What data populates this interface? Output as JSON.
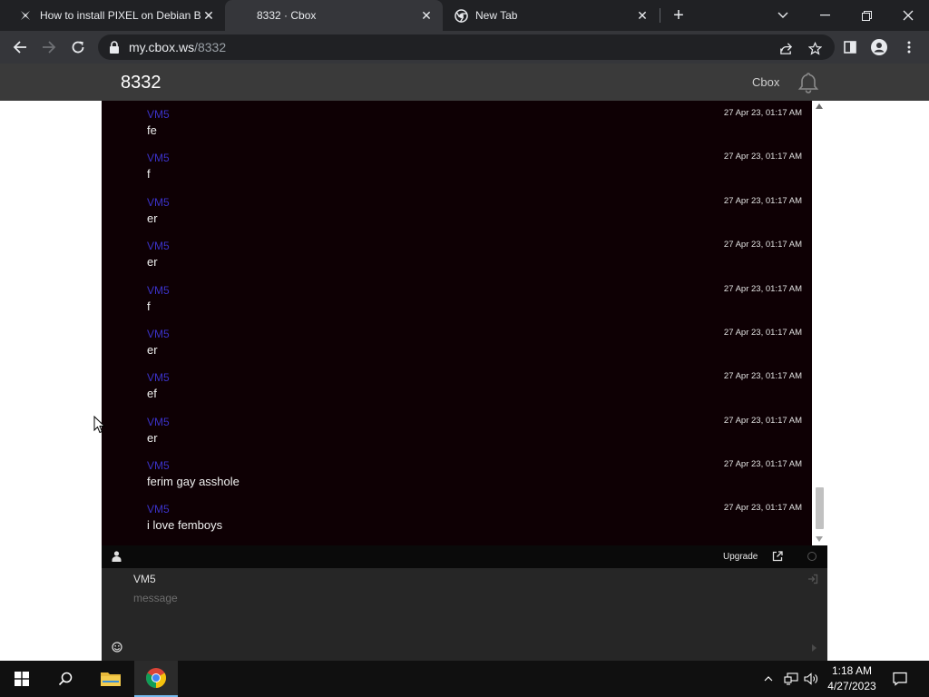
{
  "browser": {
    "tabs": [
      {
        "title": "How to install PIXEL on Debian B",
        "icon": "cross-logo-icon",
        "active": false
      },
      {
        "title": "8332 · Cbox",
        "icon": "none",
        "active": true
      },
      {
        "title": "New Tab",
        "icon": "chrome-icon",
        "active": false
      }
    ],
    "url_host": "my.cbox.ws",
    "url_path": "/8332"
  },
  "site": {
    "brand": "8332",
    "cbox_link": "Cbox"
  },
  "chat": {
    "messages": [
      {
        "user": "VM5",
        "time": "27 Apr 23, 01:17 AM",
        "text": "fe"
      },
      {
        "user": "VM5",
        "time": "27 Apr 23, 01:17 AM",
        "text": "f"
      },
      {
        "user": "VM5",
        "time": "27 Apr 23, 01:17 AM",
        "text": "er"
      },
      {
        "user": "VM5",
        "time": "27 Apr 23, 01:17 AM",
        "text": "er"
      },
      {
        "user": "VM5",
        "time": "27 Apr 23, 01:17 AM",
        "text": "f"
      },
      {
        "user": "VM5",
        "time": "27 Apr 23, 01:17 AM",
        "text": "er"
      },
      {
        "user": "VM5",
        "time": "27 Apr 23, 01:17 AM",
        "text": "ef"
      },
      {
        "user": "VM5",
        "time": "27 Apr 23, 01:17 AM",
        "text": "er"
      },
      {
        "user": "VM5",
        "time": "27 Apr 23, 01:17 AM",
        "text": "ferim gay asshole"
      },
      {
        "user": "VM5",
        "time": "27 Apr 23, 01:17 AM",
        "text": "i love femboys"
      }
    ],
    "upgrade_label": "Upgrade",
    "name_value": "VM5",
    "message_placeholder": "message"
  },
  "taskbar": {
    "time": "1:18 AM",
    "date": "4/27/2023"
  },
  "colors": {
    "chat_bg": "#0e0004",
    "username": "#3b32c8",
    "header_bg": "#3a3a3a"
  }
}
